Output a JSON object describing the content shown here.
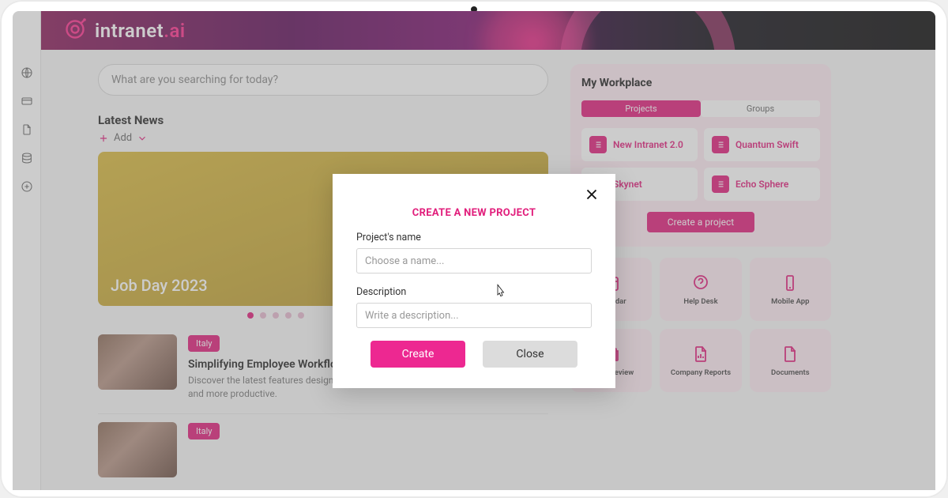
{
  "brand": {
    "name_part1": "intranet",
    "name_part2": ".ai"
  },
  "search": {
    "placeholder": "What are you searching for today?"
  },
  "news": {
    "section_title": "Latest News",
    "add_label": "Add",
    "featured_title": "Job Day 2023",
    "items": [
      {
        "tag": "Italy",
        "title": "Simplifying Employee Workflow",
        "desc": "Discover the latest features designed to make every employee's workday smoother and more productive."
      },
      {
        "tag": "Italy",
        "title": "",
        "desc": ""
      }
    ]
  },
  "workplace": {
    "title": "My Workplace",
    "tabs": {
      "projects": "Projects",
      "groups": "Groups"
    },
    "projects": [
      {
        "name": "New Intranet 2.0"
      },
      {
        "name": "Quantum Swift"
      },
      {
        "name": "Skynet"
      },
      {
        "name": "Echo Sphere"
      }
    ],
    "create_label": "Create a project"
  },
  "quicklinks": [
    {
      "label": "Calendar",
      "icon": "calendar"
    },
    {
      "label": "Help Desk",
      "icon": "help"
    },
    {
      "label": "Mobile App",
      "icon": "mobile"
    },
    {
      "label": "Press Review",
      "icon": "press"
    },
    {
      "label": "Company Reports",
      "icon": "reports"
    },
    {
      "label": "Documents",
      "icon": "documents"
    }
  ],
  "modal": {
    "title": "CREATE A NEW PROJECT",
    "name_label": "Project's name",
    "name_placeholder": "Choose a name...",
    "desc_label": "Description",
    "desc_placeholder": "Write a description...",
    "create_label": "Create",
    "close_label": "Close"
  },
  "colors": {
    "accent": "#e11d7b"
  }
}
